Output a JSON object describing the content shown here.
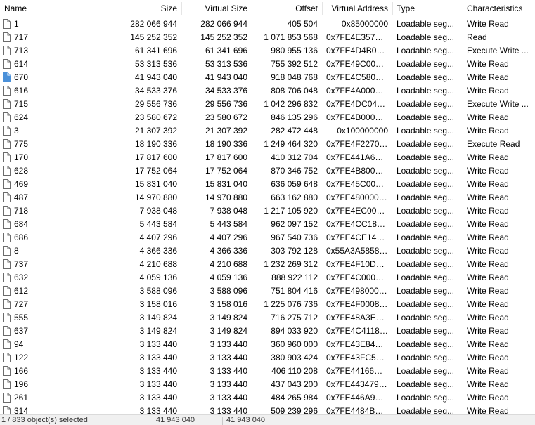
{
  "columns": [
    "Name",
    "Size",
    "Virtual Size",
    "Offset",
    "Virtual Address",
    "Type",
    "Characteristics"
  ],
  "colors": {
    "file_icon": "#ffffff",
    "file_icon_border": "#6b6b6b",
    "selected_icon": "#4a90d9"
  },
  "rows": [
    {
      "name": "1",
      "size": "282 066 944",
      "vsize": "282 066 944",
      "offset": "405 504",
      "vaddr": "0x85000000",
      "type": "Loadable seg...",
      "char": "Write Read",
      "icon": "file-icon"
    },
    {
      "name": "717",
      "size": "145 252 352",
      "vsize": "145 252 352",
      "offset": "1 071 853 568",
      "vaddr": "0x7FE4E357A000",
      "type": "Loadable seg...",
      "char": "Read",
      "icon": "file-icon"
    },
    {
      "name": "713",
      "size": "61 341 696",
      "vsize": "61 341 696",
      "offset": "980 955 136",
      "vaddr": "0x7FE4D4B0A0...",
      "type": "Loadable seg...",
      "char": "Execute Write ...",
      "icon": "file-icon"
    },
    {
      "name": "614",
      "size": "53 313 536",
      "vsize": "53 313 536",
      "offset": "755 392 512",
      "vaddr": "0x7FE49C000000",
      "type": "Loadable seg...",
      "char": "Write Read",
      "icon": "file-icon"
    },
    {
      "name": "670",
      "size": "41 943 040",
      "vsize": "41 943 040",
      "offset": "918 048 768",
      "vaddr": "0x7FE4C5800000",
      "type": "Loadable seg...",
      "char": "Write Read",
      "icon": "file-icon-selected"
    },
    {
      "name": "616",
      "size": "34 533 376",
      "vsize": "34 533 376",
      "offset": "808 706 048",
      "vaddr": "0x7FE4A0000000",
      "type": "Loadable seg...",
      "char": "Write Read",
      "icon": "file-icon"
    },
    {
      "name": "715",
      "size": "29 556 736",
      "vsize": "29 556 736",
      "offset": "1 042 296 832",
      "vaddr": "0x7FE4DC042000",
      "type": "Loadable seg...",
      "char": "Execute Write ...",
      "icon": "file-icon"
    },
    {
      "name": "624",
      "size": "23 580 672",
      "vsize": "23 580 672",
      "offset": "846 135 296",
      "vaddr": "0x7FE4B0000000",
      "type": "Loadable seg...",
      "char": "Write Read",
      "icon": "file-icon"
    },
    {
      "name": "3",
      "size": "21 307 392",
      "vsize": "21 307 392",
      "offset": "282 472 448",
      "vaddr": "0x100000000",
      "type": "Loadable seg...",
      "char": "Write Read",
      "icon": "file-icon"
    },
    {
      "name": "775",
      "size": "18 190 336",
      "vsize": "18 190 336",
      "offset": "1 249 464 320",
      "vaddr": "0x7FE4F2270000",
      "type": "Loadable seg...",
      "char": "Execute Read",
      "icon": "file-icon"
    },
    {
      "name": "170",
      "size": "17 817 600",
      "vsize": "17 817 600",
      "offset": "410 312 704",
      "vaddr": "0x7FE441A6E000",
      "type": "Loadable seg...",
      "char": "Write Read",
      "icon": "file-icon"
    },
    {
      "name": "628",
      "size": "17 752 064",
      "vsize": "17 752 064",
      "offset": "870 346 752",
      "vaddr": "0x7FE4B8000000",
      "type": "Loadable seg...",
      "char": "Write Read",
      "icon": "file-icon"
    },
    {
      "name": "469",
      "size": "15 831 040",
      "vsize": "15 831 040",
      "offset": "636 059 648",
      "vaddr": "0x7FE45C000000",
      "type": "Loadable seg...",
      "char": "Write Read",
      "icon": "file-icon"
    },
    {
      "name": "487",
      "size": "14 970 880",
      "vsize": "14 970 880",
      "offset": "663 162 880",
      "vaddr": "0x7FE480000000",
      "type": "Loadable seg...",
      "char": "Write Read",
      "icon": "file-icon"
    },
    {
      "name": "718",
      "size": "7 938 048",
      "vsize": "7 938 048",
      "offset": "1 217 105 920",
      "vaddr": "0x7FE4EC000000",
      "type": "Loadable seg...",
      "char": "Write Read",
      "icon": "file-icon"
    },
    {
      "name": "684",
      "size": "5 443 584",
      "vsize": "5 443 584",
      "offset": "962 097 152",
      "vaddr": "0x7FE4CC183000",
      "type": "Loadable seg...",
      "char": "Write Read",
      "icon": "file-icon"
    },
    {
      "name": "686",
      "size": "4 407 296",
      "vsize": "4 407 296",
      "offset": "967 540 736",
      "vaddr": "0x7FE4CE140000",
      "type": "Loadable seg...",
      "char": "Write Read",
      "icon": "file-icon"
    },
    {
      "name": "8",
      "size": "4 366 336",
      "vsize": "4 366 336",
      "offset": "303 792 128",
      "vaddr": "0x55A3A5858000",
      "type": "Loadable seg...",
      "char": "Write Read",
      "icon": "file-icon"
    },
    {
      "name": "737",
      "size": "4 210 688",
      "vsize": "4 210 688",
      "offset": "1 232 269 312",
      "vaddr": "0x7FE4F10D9000",
      "type": "Loadable seg...",
      "char": "Write Read",
      "icon": "file-icon"
    },
    {
      "name": "632",
      "size": "4 059 136",
      "vsize": "4 059 136",
      "offset": "888 922 112",
      "vaddr": "0x7FE4C0000000",
      "type": "Loadable seg...",
      "char": "Write Read",
      "icon": "file-icon"
    },
    {
      "name": "612",
      "size": "3 588 096",
      "vsize": "3 588 096",
      "offset": "751 804 416",
      "vaddr": "0x7FE498000000",
      "type": "Loadable seg...",
      "char": "Write Read",
      "icon": "file-icon"
    },
    {
      "name": "727",
      "size": "3 158 016",
      "vsize": "3 158 016",
      "offset": "1 225 076 736",
      "vaddr": "0x7FE4F0008000",
      "type": "Loadable seg...",
      "char": "Write Read",
      "icon": "file-icon"
    },
    {
      "name": "555",
      "size": "3 149 824",
      "vsize": "3 149 824",
      "offset": "716 275 712",
      "vaddr": "0x7FE48A3EB000",
      "type": "Loadable seg...",
      "char": "Write Read",
      "icon": "file-icon"
    },
    {
      "name": "637",
      "size": "3 149 824",
      "vsize": "3 149 824",
      "offset": "894 033 920",
      "vaddr": "0x7FE4C4118000",
      "type": "Loadable seg...",
      "char": "Write Read",
      "icon": "file-icon"
    },
    {
      "name": "94",
      "size": "3 133 440",
      "vsize": "3 133 440",
      "offset": "360 960 000",
      "vaddr": "0x7FE43E844000",
      "type": "Loadable seg...",
      "char": "Write Read",
      "icon": "file-icon"
    },
    {
      "name": "122",
      "size": "3 133 440",
      "vsize": "3 133 440",
      "offset": "380 903 424",
      "vaddr": "0x7FE43FC54000",
      "type": "Loadable seg...",
      "char": "Write Read",
      "icon": "file-icon"
    },
    {
      "name": "166",
      "size": "3 133 440",
      "vsize": "3 133 440",
      "offset": "406 110 208",
      "vaddr": "0x7FE44166C000",
      "type": "Loadable seg...",
      "char": "Write Read",
      "icon": "file-icon"
    },
    {
      "name": "196",
      "size": "3 133 440",
      "vsize": "3 133 440",
      "offset": "437 043 200",
      "vaddr": "0x7FE443479000",
      "type": "Loadable seg...",
      "char": "Write Read",
      "icon": "file-icon"
    },
    {
      "name": "261",
      "size": "3 133 440",
      "vsize": "3 133 440",
      "offset": "484 265 984",
      "vaddr": "0x7FE446A9F000",
      "type": "Loadable seg...",
      "char": "Write Read",
      "icon": "file-icon"
    },
    {
      "name": "314",
      "size": "3 133 440",
      "vsize": "3 133 440",
      "offset": "509 239 296",
      "vaddr": "0x7FE4484B5000",
      "type": "Loadable seg...",
      "char": "Write Read",
      "icon": "file-icon"
    }
  ],
  "status": {
    "selection": "1 / 833 object(s) selected",
    "size": "41 943 040",
    "vsize": "41 943 040"
  }
}
